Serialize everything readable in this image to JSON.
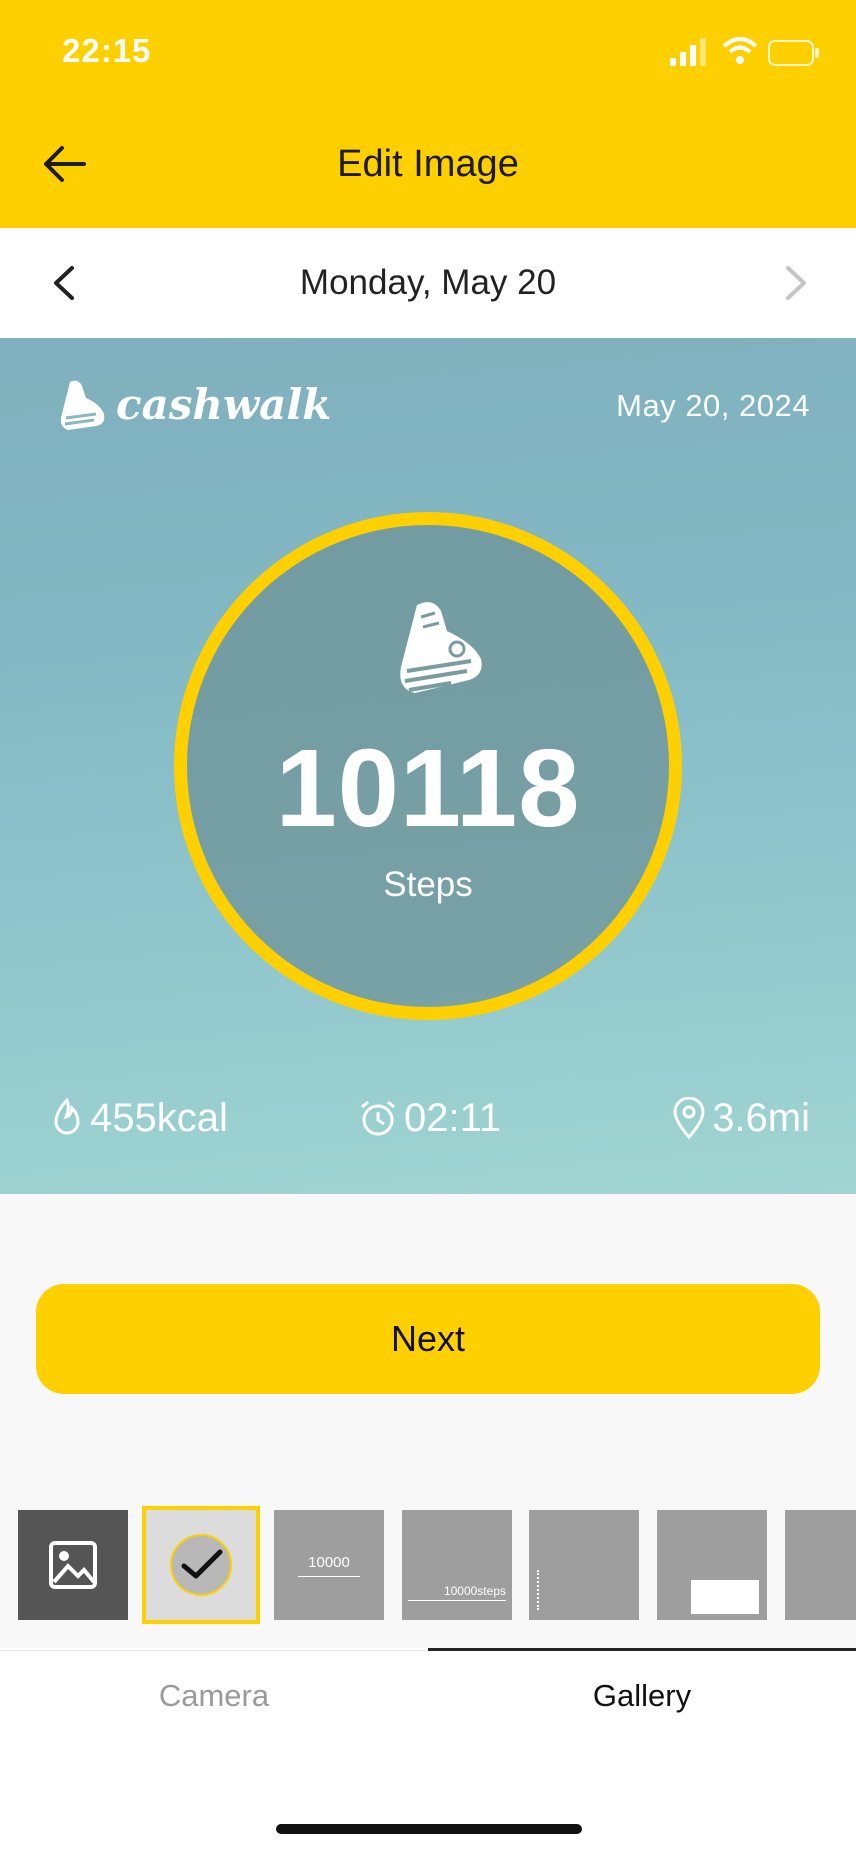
{
  "status_bar": {
    "time": "22:15"
  },
  "header": {
    "title": "Edit Image",
    "back_icon": "arrow-left-icon"
  },
  "date_nav": {
    "label": "Monday, May 20",
    "prev_icon": "chevron-left-icon",
    "next_icon": "chevron-right-icon"
  },
  "preview": {
    "brand": "cashwalk",
    "date": "May 20, 2024",
    "steps_value": "10118",
    "steps_label": "Steps",
    "stats": {
      "calories": "455kcal",
      "duration": "02:11",
      "distance": "3.6mi"
    }
  },
  "actions": {
    "next_label": "Next"
  },
  "templates": {
    "thumb2_value": "10000",
    "thumb3_value": "10000steps"
  },
  "tabs": [
    {
      "label": "Camera",
      "active": false
    },
    {
      "label": "Gallery",
      "active": true
    }
  ],
  "colors": {
    "accent": "#FFD000"
  }
}
